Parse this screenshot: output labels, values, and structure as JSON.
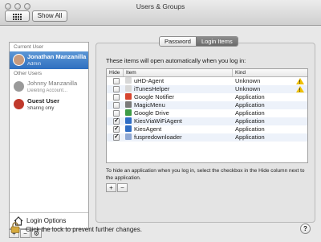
{
  "window": {
    "title": "Users & Groups"
  },
  "toolbar": {
    "show_all_label": "Show All"
  },
  "sidebar": {
    "current_user_header": "Current User",
    "other_users_header": "Other Users",
    "users": [
      {
        "name": "Jonathan Manzanilla",
        "role": "Admin",
        "selected": true
      },
      {
        "name": "Johnny Manzanilla",
        "role": "Deleting Account...",
        "selected": false
      },
      {
        "name": "Guest User",
        "role": "Sharing only",
        "selected": false
      }
    ],
    "login_options_label": "Login Options",
    "tool_add": "+",
    "tool_remove": "−",
    "tool_action": "⚙"
  },
  "tabs": {
    "password": "Password",
    "login_items": "Login Items",
    "active": "login_items"
  },
  "login_items": {
    "intro": "These items will open automatically when you log in:",
    "columns": {
      "hide": "Hide",
      "item": "Item",
      "kind": "Kind"
    },
    "rows": [
      {
        "hide": false,
        "item": "uHD-Agent",
        "kind": "Unknown",
        "warning": true,
        "icon_color": "#d8d8d8"
      },
      {
        "hide": false,
        "item": "iTunesHelper",
        "kind": "Unknown",
        "warning": true,
        "icon_color": "#d8d8d8"
      },
      {
        "hide": false,
        "item": "Google Notifier",
        "kind": "Application",
        "warning": false,
        "icon_color": "#d6452f"
      },
      {
        "hide": false,
        "item": "MagicMenu",
        "kind": "Application",
        "warning": false,
        "icon_color": "#7a7a7a"
      },
      {
        "hide": false,
        "item": "Google Drive",
        "kind": "Application",
        "warning": false,
        "icon_color": "#3f9c46"
      },
      {
        "hide": true,
        "item": "KiesViaWiFiAgent",
        "kind": "Application",
        "warning": false,
        "icon_color": "#2f6dc4"
      },
      {
        "hide": true,
        "item": "KiesAgent",
        "kind": "Application",
        "warning": false,
        "icon_color": "#2f6dc4"
      },
      {
        "hide": true,
        "item": "fuspredownloader",
        "kind": "Application",
        "warning": false,
        "icon_color": "#8fa8d4"
      }
    ],
    "hint": "To hide an application when you log in, select the checkbox in the Hide column next to the application.",
    "add": "+",
    "remove": "−"
  },
  "footer": {
    "lock_text": "Click the lock to prevent further changes.",
    "help": "?"
  }
}
